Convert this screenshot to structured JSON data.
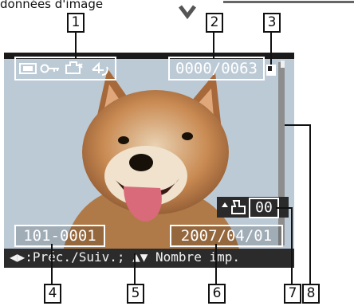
{
  "header": {
    "text": "données d'image"
  },
  "status": {
    "image_counter": "0000/0063",
    "file_number": "101-0001",
    "date": "2007/04/01",
    "print_count": "00"
  },
  "footer": {
    "hint": "◀▶:Préc./Suiv.; ▲▼ Nombre imp."
  },
  "callouts": [
    "1",
    "2",
    "3",
    "4",
    "5",
    "6",
    "7",
    "8"
  ],
  "icons": [
    "memory-card-icon",
    "protect-key-icon",
    "dpof-print-icon",
    "rotate-icon",
    "card-slot-icon",
    "printer-icon",
    "up-arrow-icon"
  ]
}
